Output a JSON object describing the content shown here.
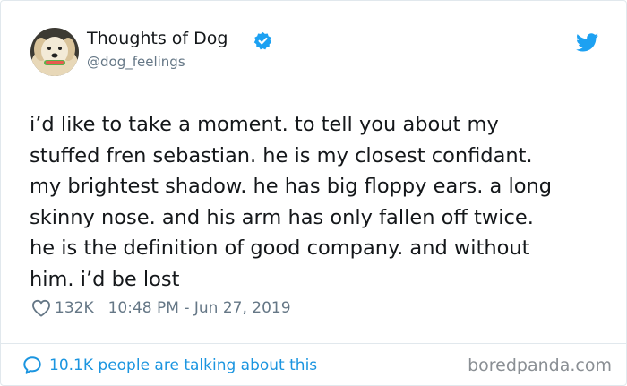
{
  "author": {
    "display_name": "Thoughts of Dog",
    "handle": "@dog_feelings",
    "avatar_icon": "dog-avatar",
    "verified_icon": "verified-badge-icon"
  },
  "tweet": {
    "lines": [
      "i’d like to take a moment. to tell you about my",
      "stuffed fren sebastian. he is my closest confidant.",
      "my brightest shadow. he has big floppy ears. a long",
      "skinny nose. and his arm has only fallen off twice.",
      "he is the definition of good company. and without",
      "him. i’d be lost"
    ],
    "likes": "132K",
    "timestamp": "10:48 PM - Jun 27, 2019",
    "talking": "10.1K people are talking about this"
  },
  "watermark": "boredpanda.com",
  "colors": {
    "twitter_blue": "#1da1f2",
    "link_blue": "#1b95e0",
    "muted": "#657786"
  }
}
